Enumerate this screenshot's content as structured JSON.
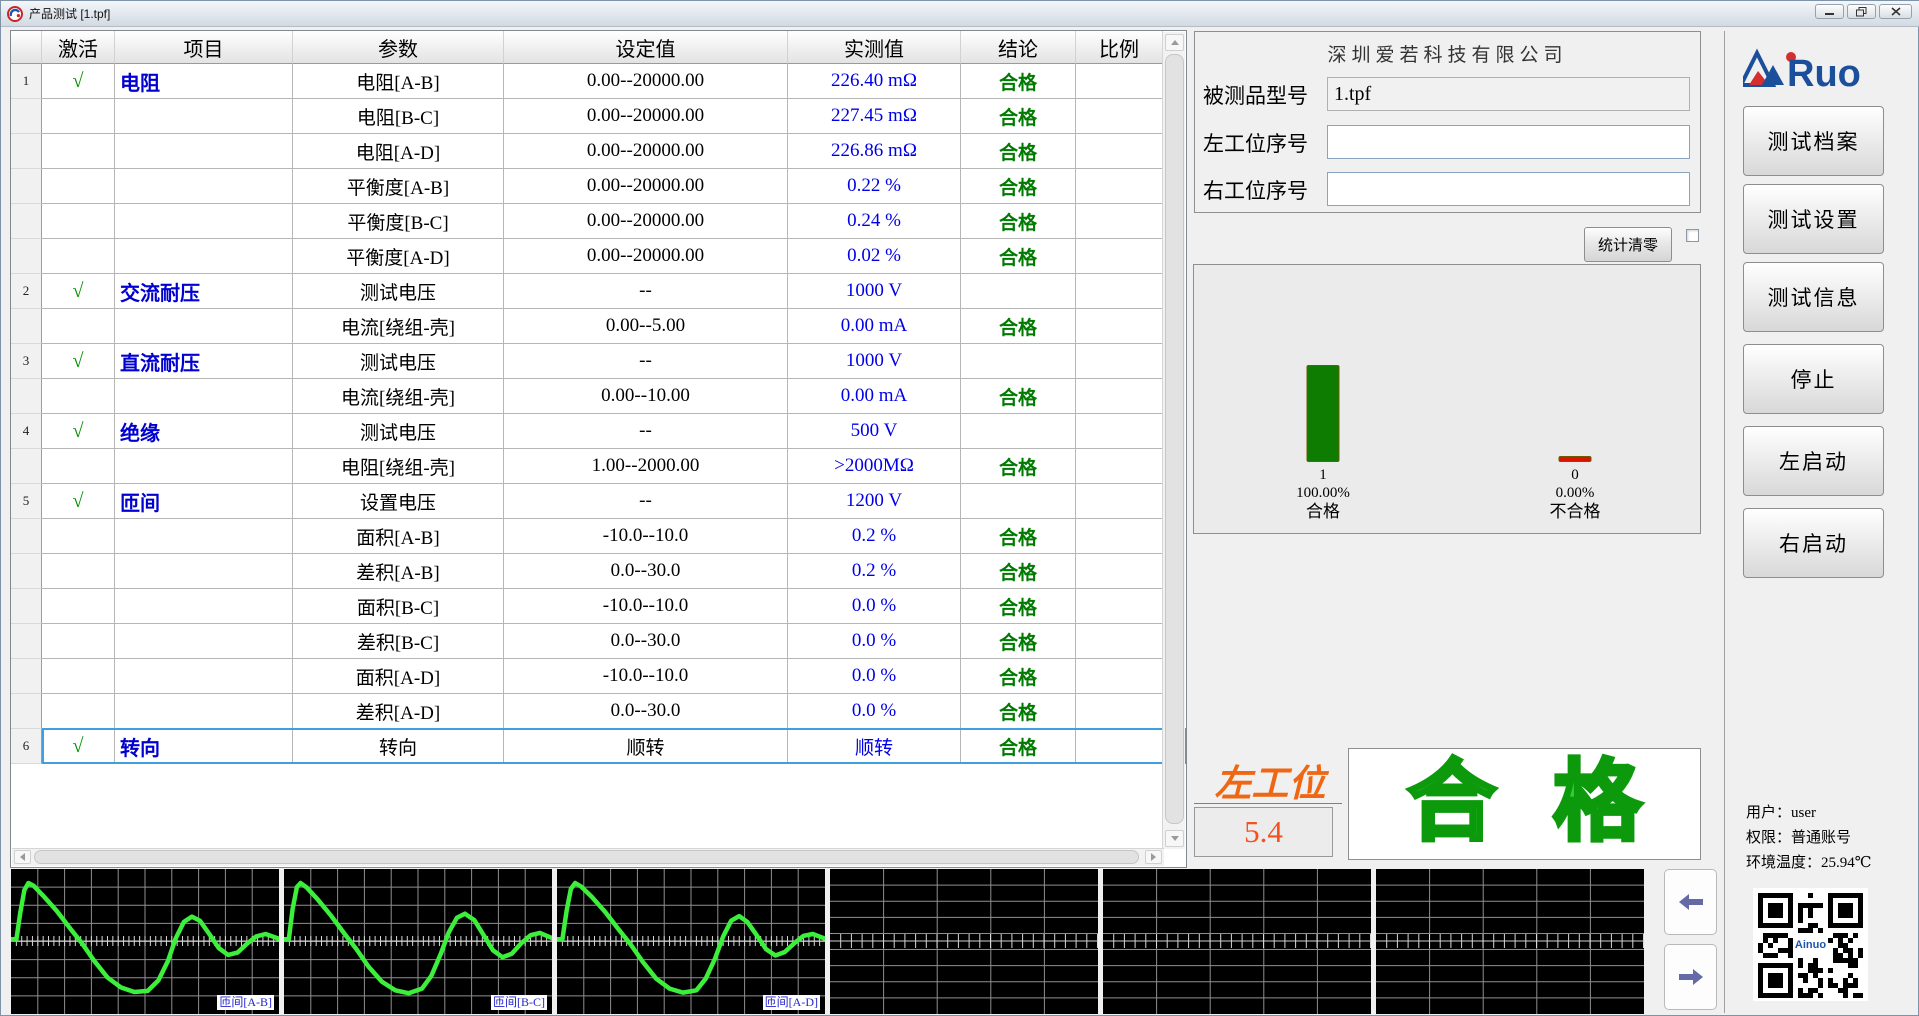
{
  "window": {
    "title": "产品测试 [1.tpf]"
  },
  "table": {
    "headers": [
      "激活",
      "项目",
      "参数",
      "设定值",
      "实测值",
      "结论",
      "比例"
    ],
    "rows": [
      {
        "num": "1",
        "check": "√",
        "item": "电阻",
        "param": "电阻[A-B]",
        "set": "0.00--20000.00",
        "actual": "226.40 mΩ",
        "result": "合格",
        "selected": false
      },
      {
        "num": "",
        "check": "",
        "item": "",
        "param": "电阻[B-C]",
        "set": "0.00--20000.00",
        "actual": "227.45 mΩ",
        "result": "合格",
        "selected": false
      },
      {
        "num": "",
        "check": "",
        "item": "",
        "param": "电阻[A-D]",
        "set": "0.00--20000.00",
        "actual": "226.86 mΩ",
        "result": "合格",
        "selected": false
      },
      {
        "num": "",
        "check": "",
        "item": "",
        "param": "平衡度[A-B]",
        "set": "0.00--20000.00",
        "actual": "0.22 %",
        "result": "合格",
        "selected": false
      },
      {
        "num": "",
        "check": "",
        "item": "",
        "param": "平衡度[B-C]",
        "set": "0.00--20000.00",
        "actual": "0.24 %",
        "result": "合格",
        "selected": false
      },
      {
        "num": "",
        "check": "",
        "item": "",
        "param": "平衡度[A-D]",
        "set": "0.00--20000.00",
        "actual": "0.02 %",
        "result": "合格",
        "selected": false
      },
      {
        "num": "2",
        "check": "√",
        "item": "交流耐压",
        "param": "测试电压",
        "set": "--",
        "actual": "1000 V",
        "result": "",
        "selected": false
      },
      {
        "num": "",
        "check": "",
        "item": "",
        "param": "电流[绕组-壳]",
        "set": "0.00--5.00",
        "actual": "0.00 mA",
        "result": "合格",
        "selected": false
      },
      {
        "num": "3",
        "check": "√",
        "item": "直流耐压",
        "param": "测试电压",
        "set": "--",
        "actual": "1000 V",
        "result": "",
        "selected": false
      },
      {
        "num": "",
        "check": "",
        "item": "",
        "param": "电流[绕组-壳]",
        "set": "0.00--10.00",
        "actual": "0.00 mA",
        "result": "合格",
        "selected": false
      },
      {
        "num": "4",
        "check": "√",
        "item": "绝缘",
        "param": "测试电压",
        "set": "--",
        "actual": "500 V",
        "result": "",
        "selected": false
      },
      {
        "num": "",
        "check": "",
        "item": "",
        "param": "电阻[绕组-壳]",
        "set": "1.00--2000.00",
        "actual": ">2000MΩ",
        "result": "合格",
        "selected": false
      },
      {
        "num": "5",
        "check": "√",
        "item": "匝间",
        "param": "设置电压",
        "set": "--",
        "actual": "1200 V",
        "result": "",
        "selected": false
      },
      {
        "num": "",
        "check": "",
        "item": "",
        "param": "面积[A-B]",
        "set": "-10.0--10.0",
        "actual": "0.2 %",
        "result": "合格",
        "selected": false
      },
      {
        "num": "",
        "check": "",
        "item": "",
        "param": "差积[A-B]",
        "set": "0.0--30.0",
        "actual": "0.2 %",
        "result": "合格",
        "selected": false
      },
      {
        "num": "",
        "check": "",
        "item": "",
        "param": "面积[B-C]",
        "set": "-10.0--10.0",
        "actual": "0.0 %",
        "result": "合格",
        "selected": false
      },
      {
        "num": "",
        "check": "",
        "item": "",
        "param": "差积[B-C]",
        "set": "0.0--30.0",
        "actual": "0.0 %",
        "result": "合格",
        "selected": false
      },
      {
        "num": "",
        "check": "",
        "item": "",
        "param": "面积[A-D]",
        "set": "-10.0--10.0",
        "actual": "0.0 %",
        "result": "合格",
        "selected": false
      },
      {
        "num": "",
        "check": "",
        "item": "",
        "param": "差积[A-D]",
        "set": "0.0--30.0",
        "actual": "0.0 %",
        "result": "合格",
        "selected": false
      },
      {
        "num": "6",
        "check": "√",
        "item": "转向",
        "param": "转向",
        "set": "顺转",
        "actual": "顺转",
        "result": "合格",
        "selected": true
      }
    ]
  },
  "info_panel": {
    "company": "深圳爱若科技有限公司",
    "fields": [
      {
        "label": "被测品型号",
        "value": "1.tpf"
      },
      {
        "label": "左工位序号",
        "value": ""
      },
      {
        "label": "右工位序号",
        "value": ""
      }
    ],
    "clear_stats_button": "统计清零"
  },
  "chart_data": {
    "type": "bar",
    "categories": [
      "合格",
      "不合格"
    ],
    "values": [
      1,
      0
    ],
    "count_labels": [
      "1",
      "0"
    ],
    "percent_labels": [
      "100.00%",
      "0.00%"
    ],
    "colors": [
      "#0e7c00",
      "#dd1100"
    ],
    "title": "",
    "xlabel": "",
    "ylabel": "",
    "ylim": [
      0,
      2
    ],
    "grid": false,
    "legend": "none"
  },
  "station": {
    "name": "左工位",
    "time": "5.4",
    "result_chars": [
      "合",
      "格"
    ]
  },
  "sidebar": {
    "logo_text": "Ruo",
    "buttons": [
      "测试档案",
      "测试设置",
      "测试信息",
      "停止",
      "左启动",
      "右启动"
    ],
    "user_lines": [
      "用户：user",
      "权限：普通账号",
      "环境温度：25.94℃"
    ],
    "qr_label": "Ainuo"
  },
  "waveforms": {
    "panels": [
      {
        "label": "匝间[A-B]",
        "cols": 10,
        "rows": 8,
        "points": [
          [
            0,
            0.03
          ],
          [
            0.02,
            0.03
          ],
          [
            0.035,
            0.5
          ],
          [
            0.05,
            0.88
          ],
          [
            0.065,
            1.0
          ],
          [
            0.085,
            0.95
          ],
          [
            0.12,
            0.78
          ],
          [
            0.17,
            0.52
          ],
          [
            0.22,
            0.22
          ],
          [
            0.265,
            -0.04
          ],
          [
            0.31,
            -0.34
          ],
          [
            0.36,
            -0.63
          ],
          [
            0.41,
            -0.8
          ],
          [
            0.46,
            -0.88
          ],
          [
            0.51,
            -0.86
          ],
          [
            0.55,
            -0.68
          ],
          [
            0.585,
            -0.35
          ],
          [
            0.615,
            0.05
          ],
          [
            0.645,
            0.33
          ],
          [
            0.675,
            0.42
          ],
          [
            0.705,
            0.35
          ],
          [
            0.74,
            0.12
          ],
          [
            0.775,
            -0.12
          ],
          [
            0.81,
            -0.24
          ],
          [
            0.845,
            -0.2
          ],
          [
            0.88,
            -0.05
          ],
          [
            0.915,
            0.08
          ],
          [
            0.95,
            0.12
          ],
          [
            0.975,
            0.08
          ],
          [
            1,
            0.04
          ]
        ]
      },
      {
        "label": "匝间[B-C]",
        "cols": 10,
        "rows": 8,
        "points": [
          [
            0,
            0.03
          ],
          [
            0.018,
            0.03
          ],
          [
            0.032,
            0.55
          ],
          [
            0.048,
            0.93
          ],
          [
            0.062,
            1.0
          ],
          [
            0.085,
            0.92
          ],
          [
            0.125,
            0.72
          ],
          [
            0.175,
            0.44
          ],
          [
            0.225,
            0.13
          ],
          [
            0.27,
            -0.14
          ],
          [
            0.315,
            -0.44
          ],
          [
            0.365,
            -0.7
          ],
          [
            0.415,
            -0.85
          ],
          [
            0.465,
            -0.9
          ],
          [
            0.515,
            -0.82
          ],
          [
            0.55,
            -0.6
          ],
          [
            0.585,
            -0.22
          ],
          [
            0.615,
            0.15
          ],
          [
            0.645,
            0.4
          ],
          [
            0.675,
            0.47
          ],
          [
            0.71,
            0.36
          ],
          [
            0.745,
            0.1
          ],
          [
            0.78,
            -0.16
          ],
          [
            0.815,
            -0.28
          ],
          [
            0.85,
            -0.22
          ],
          [
            0.885,
            -0.04
          ],
          [
            0.92,
            0.1
          ],
          [
            0.955,
            0.14
          ],
          [
            1,
            0.05
          ]
        ]
      },
      {
        "label": "匝间[A-D]",
        "cols": 10,
        "rows": 8,
        "points": [
          [
            0,
            0.03
          ],
          [
            0.02,
            0.03
          ],
          [
            0.036,
            0.52
          ],
          [
            0.052,
            0.9
          ],
          [
            0.068,
            1.0
          ],
          [
            0.09,
            0.94
          ],
          [
            0.13,
            0.76
          ],
          [
            0.18,
            0.5
          ],
          [
            0.23,
            0.2
          ],
          [
            0.275,
            -0.06
          ],
          [
            0.32,
            -0.36
          ],
          [
            0.37,
            -0.65
          ],
          [
            0.42,
            -0.82
          ],
          [
            0.47,
            -0.89
          ],
          [
            0.52,
            -0.85
          ],
          [
            0.555,
            -0.65
          ],
          [
            0.59,
            -0.3
          ],
          [
            0.62,
            0.08
          ],
          [
            0.65,
            0.35
          ],
          [
            0.68,
            0.43
          ],
          [
            0.71,
            0.33
          ],
          [
            0.745,
            0.1
          ],
          [
            0.78,
            -0.14
          ],
          [
            0.815,
            -0.25
          ],
          [
            0.85,
            -0.19
          ],
          [
            0.885,
            -0.04
          ],
          [
            0.92,
            0.09
          ],
          [
            0.955,
            0.12
          ],
          [
            1,
            0.04
          ]
        ]
      },
      {
        "label": "",
        "cols": 5,
        "rows": 9,
        "points": []
      },
      {
        "label": "",
        "cols": 5,
        "rows": 9,
        "points": []
      },
      {
        "label": "",
        "cols": 5,
        "rows": 9,
        "points": []
      }
    ],
    "wave_color": "#3bef3b"
  }
}
